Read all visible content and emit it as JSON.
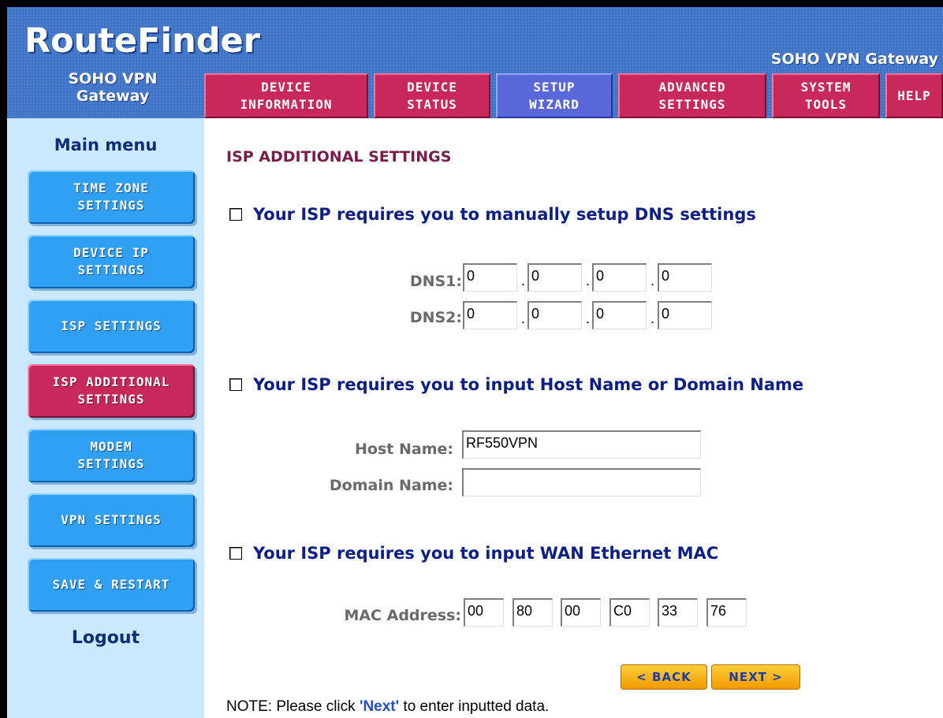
{
  "header": {
    "logo": "RouteFinder",
    "tagline": "SOHO VPN Gateway",
    "brand_sub_line1": "SOHO VPN",
    "brand_sub_line2": "Gateway"
  },
  "tabs": [
    {
      "line1": "DEVICE",
      "line2": "INFORMATION"
    },
    {
      "line1": "DEVICE",
      "line2": "STATUS"
    },
    {
      "line1": "SETUP",
      "line2": "WIZARD",
      "active": true
    },
    {
      "line1": "ADVANCED",
      "line2": "SETTINGS"
    },
    {
      "line1": "SYSTEM",
      "line2": "TOOLS"
    },
    {
      "line1": "HELP",
      "line2": ""
    }
  ],
  "sidebar": {
    "title": "Main menu",
    "items": [
      {
        "line1": "TIME ZONE",
        "line2": "SETTINGS"
      },
      {
        "line1": "DEVICE IP",
        "line2": "SETTINGS"
      },
      {
        "line1": "ISP SETTINGS",
        "line2": ""
      },
      {
        "line1": "ISP ADDITIONAL",
        "line2": "SETTINGS",
        "active": true
      },
      {
        "line1": "MODEM",
        "line2": "SETTINGS"
      },
      {
        "line1": "VPN SETTINGS",
        "line2": ""
      },
      {
        "line1": "SAVE & RESTART",
        "line2": ""
      }
    ],
    "logout": "Logout"
  },
  "main": {
    "title": "ISP ADDITIONAL SETTINGS",
    "dns": {
      "checkbox_label": "Your ISP requires you to manually setup DNS settings",
      "dns1_label": "DNS1:",
      "dns2_label": "DNS2:",
      "dns1": [
        "0",
        "0",
        "0",
        "0"
      ],
      "dns2": [
        "0",
        "0",
        "0",
        "0"
      ]
    },
    "host": {
      "checkbox_label": "Your ISP requires you to input Host Name or Domain Name",
      "host_label": "Host Name:",
      "host_value": "RF550VPN",
      "domain_label": "Domain Name:",
      "domain_value": ""
    },
    "mac": {
      "checkbox_label": "Your ISP requires you to input WAN Ethernet MAC",
      "mac_label": "MAC Address:",
      "mac": [
        "00",
        "80",
        "00",
        "C0",
        "33",
        "76"
      ]
    },
    "back_label": "< BACK",
    "next_label": "NEXT >",
    "note_prefix": "NOTE: Please click ",
    "note_emph": "'Next'",
    "note_suffix": " to enter inputted data."
  }
}
